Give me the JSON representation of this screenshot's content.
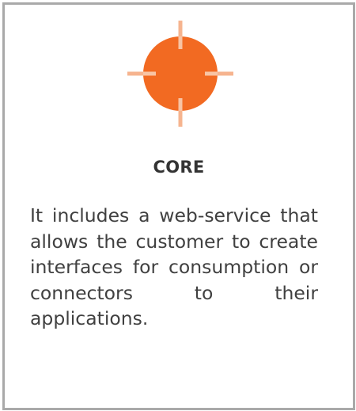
{
  "card": {
    "icon_name": "crosshair-circle-icon",
    "accent_color": "#f26a22",
    "title": "CORE",
    "description": "It includes a web-service that allows the customer to create interfaces for consumption or connectors to their applications."
  }
}
